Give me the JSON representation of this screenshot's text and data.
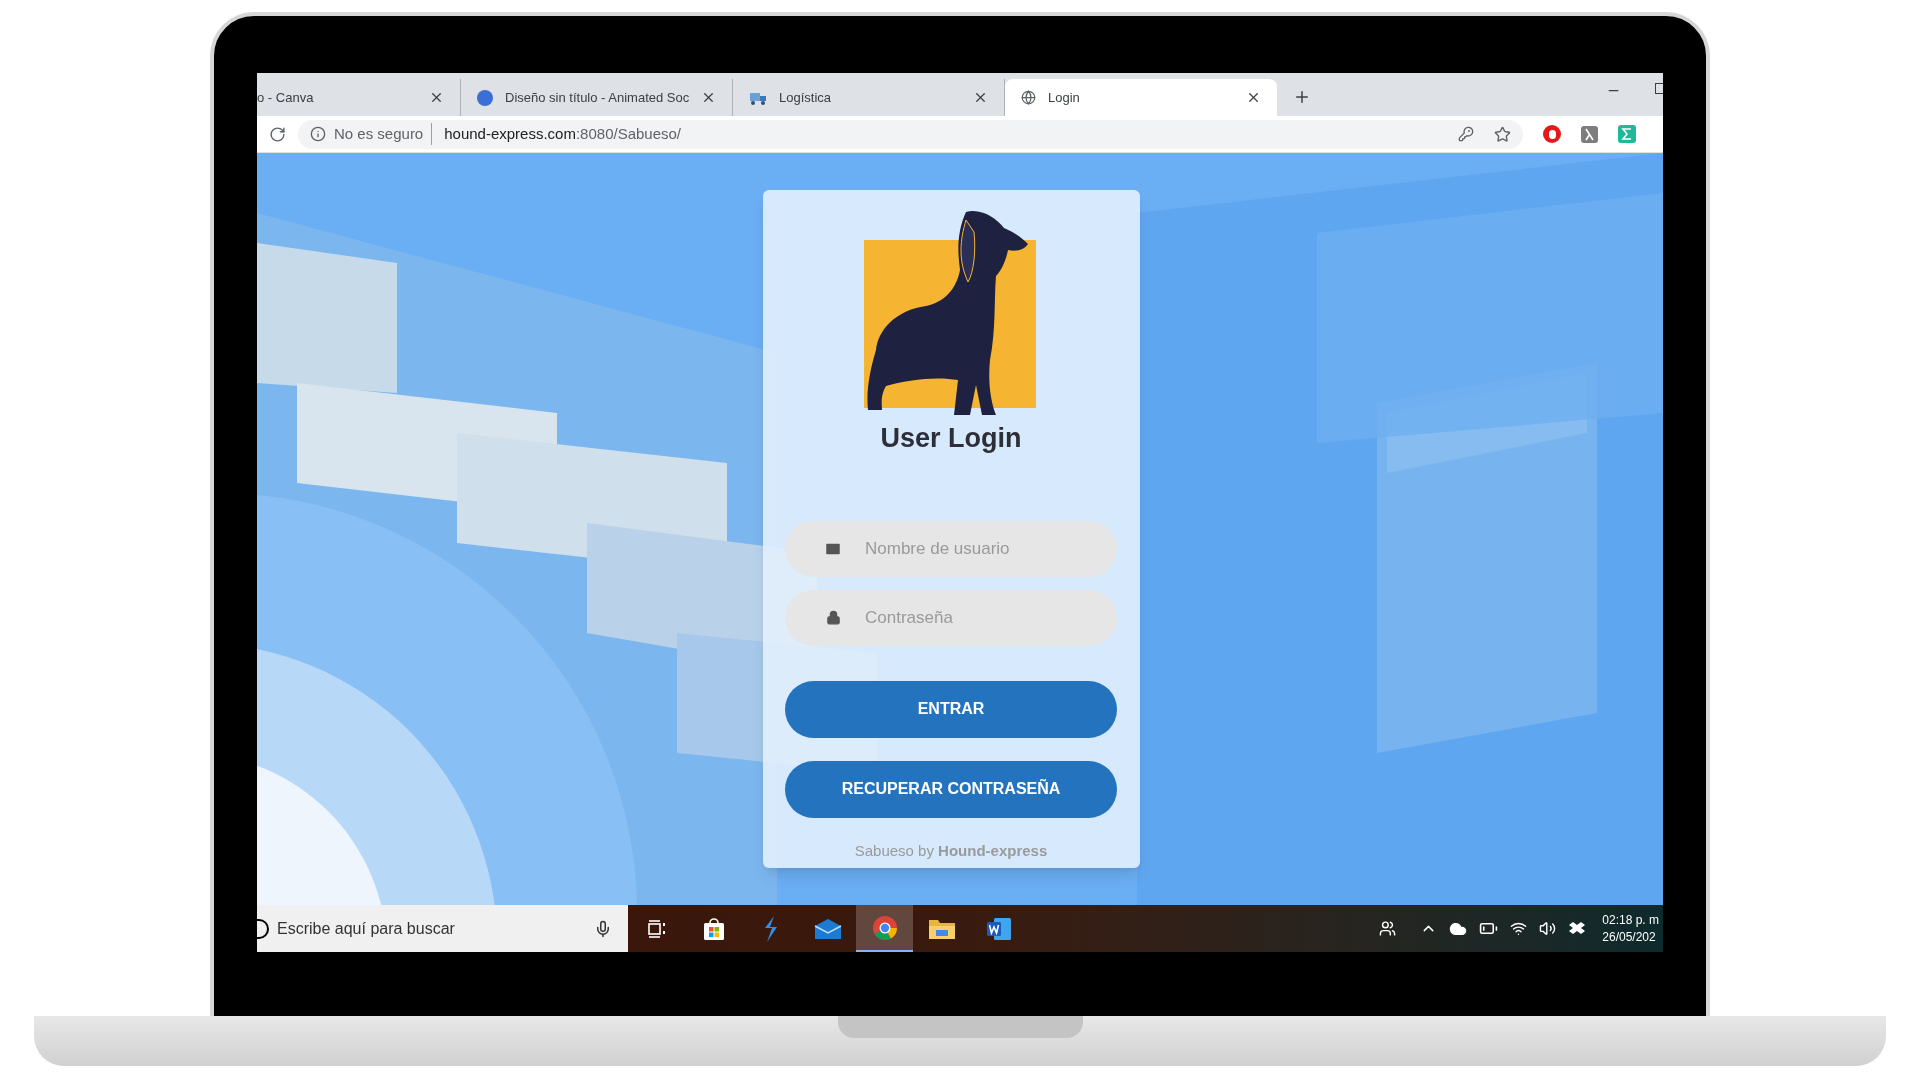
{
  "browser": {
    "tabs": [
      {
        "title": "o - Canva",
        "kind": "plain",
        "selected": false
      },
      {
        "title": "Diseño sin título - Animated Soc",
        "kind": "canva",
        "selected": false
      },
      {
        "title": "Logística",
        "kind": "logistics",
        "selected": false
      },
      {
        "title": "Login",
        "kind": "globe",
        "selected": true
      }
    ],
    "security": "No es seguro",
    "url_host": "hound-express.com",
    "url_path": ":8080/Sabueso/"
  },
  "login": {
    "title": "User Login",
    "fields": [
      {
        "kind": "email",
        "placeholder": "Nombre de usuario"
      },
      {
        "kind": "password",
        "placeholder": "Contraseña"
      }
    ],
    "buttons": [
      "ENTRAR",
      "RECUPERAR CONTRASEÑA"
    ],
    "footer": "Sabueso by **Hound-express**"
  },
  "taskbar": {
    "search_placeholder": "Escribe aquí para buscar",
    "apps": [
      {
        "kind": "taskview",
        "selected": false
      },
      {
        "kind": "store",
        "selected": false
      },
      {
        "kind": "bolt",
        "selected": false
      },
      {
        "kind": "mail",
        "selected": false
      },
      {
        "kind": "chrome",
        "selected": true
      },
      {
        "kind": "folder",
        "selected": false
      },
      {
        "kind": "word",
        "selected": false
      }
    ],
    "time": "02:18 p. m",
    "date": "26/05/202"
  }
}
